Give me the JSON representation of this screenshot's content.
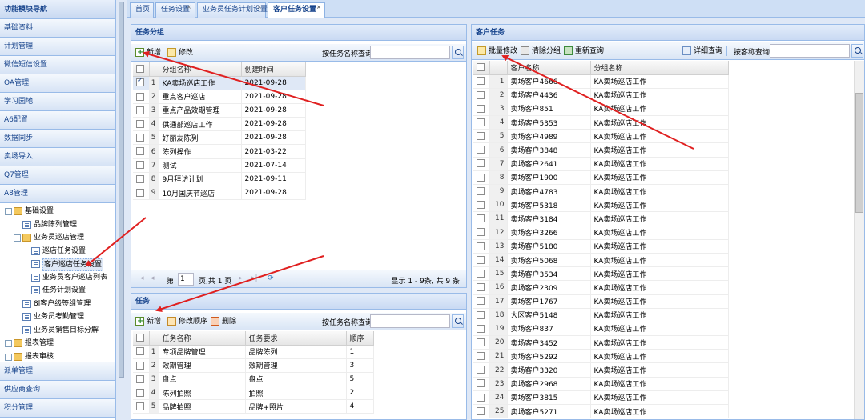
{
  "sidebar": {
    "title": "功能模块导航",
    "top_items": [
      "基础资料",
      "计划管理",
      "微信短信设置",
      "OA管理",
      "学习园地",
      "A6配置",
      "数据同步",
      "卖场导入",
      "Q7管理",
      "A8管理"
    ],
    "tree": [
      {
        "label": "基础设置",
        "indent": 0,
        "type": "folder",
        "expander": "−"
      },
      {
        "label": "品牌陈列管理",
        "indent": 1,
        "type": "leaf"
      },
      {
        "label": "业务员巡店管理",
        "indent": 1,
        "type": "folder",
        "expander": "−"
      },
      {
        "label": "巡店任务设置",
        "indent": 2,
        "type": "leaf"
      },
      {
        "label": "客户巡店任务设置",
        "indent": 2,
        "type": "leaf",
        "selected": true
      },
      {
        "label": "业务员客户巡店列表",
        "indent": 2,
        "type": "leaf"
      },
      {
        "label": "任务计划设置",
        "indent": 2,
        "type": "leaf"
      },
      {
        "label": "8l客户级签组管理",
        "indent": 1,
        "type": "leaf"
      },
      {
        "label": "业务员考勤管理",
        "indent": 1,
        "type": "leaf"
      },
      {
        "label": "业务员销售目标分解",
        "indent": 1,
        "type": "leaf"
      },
      {
        "label": "报表管理",
        "indent": 0,
        "type": "folder",
        "expander": "+"
      },
      {
        "label": "报表审核",
        "indent": 0,
        "type": "folder",
        "expander": "+"
      }
    ],
    "bottom_items": [
      "派单管理",
      "供应商查询",
      "积分管理"
    ]
  },
  "tabs": [
    {
      "label": "首页",
      "closable": false
    },
    {
      "label": "任务设置",
      "closable": true
    },
    {
      "label": "业务员任务计划设置",
      "closable": true
    },
    {
      "label": "客户任务设置",
      "closable": true,
      "active": true
    }
  ],
  "group_panel": {
    "title": "任务分组",
    "add_label": "新增",
    "edit_label": "修改",
    "search_label": "按任务名称查询:",
    "search_value": "",
    "columns": [
      "分组名称",
      "创建时间"
    ],
    "rows": [
      {
        "n": "1",
        "name": "KA卖场巡店工作",
        "date": "2021-09-28",
        "checked": true
      },
      {
        "n": "2",
        "name": "重点客户巡店",
        "date": "2021-09-28"
      },
      {
        "n": "3",
        "name": "重点产品效期管理",
        "date": "2021-09-28"
      },
      {
        "n": "4",
        "name": "供通部巡店工作",
        "date": "2021-09-28"
      },
      {
        "n": "5",
        "name": "好丽友陈列",
        "date": "2021-09-28"
      },
      {
        "n": "6",
        "name": "陈列操作",
        "date": "2021-03-22"
      },
      {
        "n": "7",
        "name": "测试",
        "date": "2021-07-14"
      },
      {
        "n": "8",
        "name": "9月拜访计划",
        "date": "2021-09-11"
      },
      {
        "n": "9",
        "name": "10月国庆节巡店",
        "date": "2021-09-28"
      }
    ],
    "pager": {
      "page_label": "第",
      "page_value": "1",
      "page_total": "页,共 1 页",
      "summary": "显示 1 - 9条, 共 9 条"
    }
  },
  "task_panel": {
    "title": "任务",
    "add_label": "新增",
    "sort_label": "修改顺序",
    "delete_label": "删除",
    "search_label": "按任务名称查询:",
    "search_value": "",
    "columns": [
      "任务名称",
      "任务要求",
      "顺序"
    ],
    "rows": [
      {
        "n": "1",
        "name": "专项品牌管理",
        "req": "品牌陈列",
        "order": "1"
      },
      {
        "n": "2",
        "name": "效期管理",
        "req": "效期管理",
        "order": "3"
      },
      {
        "n": "3",
        "name": "盘点",
        "req": "盘点",
        "order": "5"
      },
      {
        "n": "4",
        "name": "陈列拍照",
        "req": "拍照",
        "order": "2"
      },
      {
        "n": "5",
        "name": "品牌拍照",
        "req": "品牌+照片",
        "order": "4"
      }
    ]
  },
  "customer_panel": {
    "title": "客户任务",
    "batch_label": "批量修改",
    "clear_label": "清除分组",
    "requery_label": "重新查询",
    "detail_label": "详细查询",
    "search_label": "按客称查询:",
    "search_value": "",
    "columns": [
      "客户名称",
      "分组名称"
    ],
    "rows": [
      {
        "n": "1",
        "name": "卖场客户4666",
        "group": "KA卖场巡店工作"
      },
      {
        "n": "2",
        "name": "卖场客户4436",
        "group": "KA卖场巡店工作"
      },
      {
        "n": "3",
        "name": "卖场客户851",
        "group": "KA卖场巡店工作"
      },
      {
        "n": "4",
        "name": "卖场客户5353",
        "group": "KA卖场巡店工作"
      },
      {
        "n": "5",
        "name": "卖场客户4989",
        "group": "KA卖场巡店工作"
      },
      {
        "n": "6",
        "name": "卖场客户3848",
        "group": "KA卖场巡店工作"
      },
      {
        "n": "7",
        "name": "卖场客户2641",
        "group": "KA卖场巡店工作"
      },
      {
        "n": "8",
        "name": "卖场客户1900",
        "group": "KA卖场巡店工作"
      },
      {
        "n": "9",
        "name": "卖场客户4783",
        "group": "KA卖场巡店工作"
      },
      {
        "n": "10",
        "name": "卖场客户5318",
        "group": "KA卖场巡店工作"
      },
      {
        "n": "11",
        "name": "卖场客户3184",
        "group": "KA卖场巡店工作"
      },
      {
        "n": "12",
        "name": "卖场客户3266",
        "group": "KA卖场巡店工作"
      },
      {
        "n": "13",
        "name": "卖场客户5180",
        "group": "KA卖场巡店工作"
      },
      {
        "n": "14",
        "name": "卖场客户5068",
        "group": "KA卖场巡店工作"
      },
      {
        "n": "15",
        "name": "卖场客户3534",
        "group": "KA卖场巡店工作"
      },
      {
        "n": "16",
        "name": "卖场客户2309",
        "group": "KA卖场巡店工作"
      },
      {
        "n": "17",
        "name": "卖场客户1767",
        "group": "KA卖场巡店工作"
      },
      {
        "n": "18",
        "name": "大区客户5148",
        "group": "KA卖场巡店工作"
      },
      {
        "n": "19",
        "name": "卖场客户837",
        "group": "KA卖场巡店工作"
      },
      {
        "n": "20",
        "name": "卖场客户3452",
        "group": "KA卖场巡店工作"
      },
      {
        "n": "21",
        "name": "卖场客户5292",
        "group": "KA卖场巡店工作"
      },
      {
        "n": "22",
        "name": "卖场客户3320",
        "group": "KA卖场巡店工作"
      },
      {
        "n": "23",
        "name": "卖场客户2968",
        "group": "KA卖场巡店工作"
      },
      {
        "n": "24",
        "name": "卖场客户3815",
        "group": "KA卖场巡店工作"
      },
      {
        "n": "25",
        "name": "卖场客户5271",
        "group": "KA卖场巡店工作"
      }
    ]
  },
  "annotation_color": "#e02020"
}
